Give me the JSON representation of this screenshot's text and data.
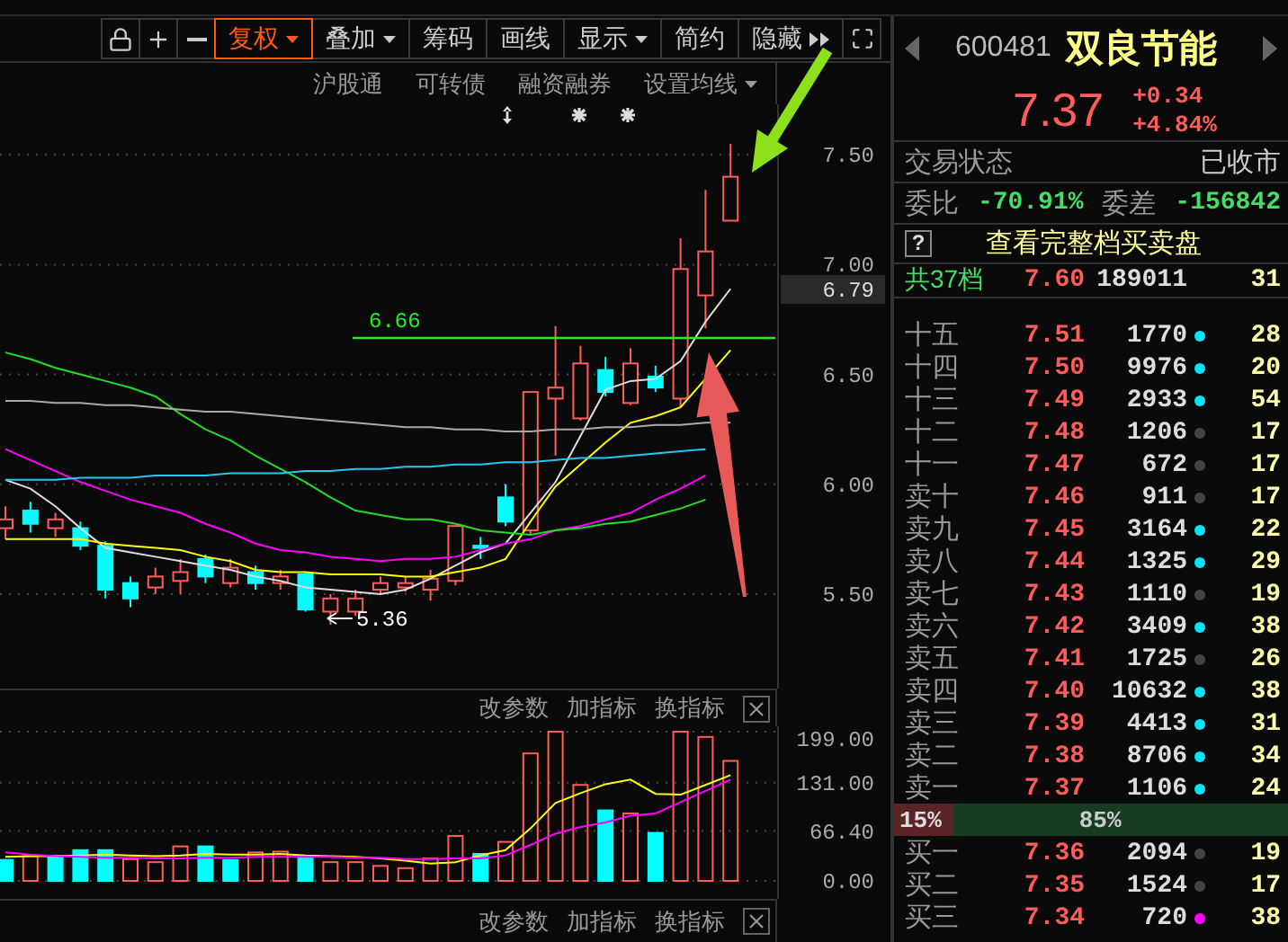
{
  "toolbar": {
    "buttons": [
      {
        "label": "复权",
        "kind": "menu",
        "selected": true
      },
      {
        "label": "叠加",
        "kind": "menu",
        "selected": false
      },
      {
        "label": "筹码",
        "kind": "plain",
        "selected": false
      },
      {
        "label": "画线",
        "kind": "plain",
        "selected": false
      },
      {
        "label": "显示",
        "kind": "menu",
        "selected": false
      },
      {
        "label": "简约",
        "kind": "plain",
        "selected": false
      },
      {
        "label": "隐藏",
        "kind": "expand",
        "selected": false
      }
    ]
  },
  "sub_toolbar": {
    "links": [
      "沪股通",
      "可转债",
      "融资融券"
    ],
    "setting": "设置均线"
  },
  "price_chart": {
    "current_price": "6.79",
    "support_label": "6.66",
    "low_label": "5.36",
    "chart_data": {
      "type": "candlestick",
      "grid": true,
      "ylim": [
        5.07,
        7.73
      ],
      "ohlc": [
        [
          5.8,
          5.9,
          5.75,
          5.84
        ],
        [
          5.88,
          5.92,
          5.78,
          5.82
        ],
        [
          5.8,
          5.87,
          5.76,
          5.84
        ],
        [
          5.8,
          5.83,
          5.7,
          5.72
        ],
        [
          5.72,
          5.74,
          5.48,
          5.52
        ],
        [
          5.55,
          5.58,
          5.44,
          5.48
        ],
        [
          5.53,
          5.62,
          5.5,
          5.58
        ],
        [
          5.56,
          5.66,
          5.5,
          5.6
        ],
        [
          5.66,
          5.68,
          5.55,
          5.58
        ],
        [
          5.55,
          5.66,
          5.53,
          5.62
        ],
        [
          5.6,
          5.63,
          5.52,
          5.55
        ],
        [
          5.55,
          5.61,
          5.52,
          5.58
        ],
        [
          5.59,
          5.6,
          5.42,
          5.43
        ],
        [
          5.42,
          5.5,
          5.36,
          5.48
        ],
        [
          5.42,
          5.52,
          5.4,
          5.48
        ],
        [
          5.52,
          5.58,
          5.5,
          5.55
        ],
        [
          5.53,
          5.58,
          5.51,
          5.55
        ],
        [
          5.52,
          5.61,
          5.47,
          5.57
        ],
        [
          5.56,
          5.81,
          5.54,
          5.81
        ],
        [
          5.72,
          5.76,
          5.66,
          5.71
        ],
        [
          5.94,
          6.0,
          5.81,
          5.83
        ],
        [
          5.79,
          6.42,
          5.77,
          6.42
        ],
        [
          6.39,
          6.72,
          6.13,
          6.44
        ],
        [
          6.3,
          6.63,
          6.29,
          6.55
        ],
        [
          6.52,
          6.58,
          6.4,
          6.42
        ],
        [
          6.37,
          6.62,
          6.36,
          6.55
        ],
        [
          6.49,
          6.54,
          6.42,
          6.44
        ],
        [
          6.39,
          7.12,
          6.35,
          6.98
        ],
        [
          6.86,
          7.34,
          6.71,
          7.06
        ],
        [
          7.2,
          7.55,
          7.2,
          7.4
        ]
      ],
      "yticks": [
        {
          "value": 7.5,
          "label": "7.50"
        },
        {
          "value": 7,
          "label": "7.00"
        },
        {
          "value": 6.5,
          "label": "6.50"
        },
        {
          "value": 6,
          "label": "6.00"
        },
        {
          "value": 5.5,
          "label": "5.50"
        }
      ],
      "series": [
        {
          "type": "line",
          "color": "#dddddd",
          "values": [
            6.02,
            5.98,
            5.9,
            5.8,
            5.71,
            5.69,
            5.67,
            5.65,
            5.63,
            5.61,
            5.58,
            5.56,
            5.53,
            5.52,
            5.51,
            5.5,
            5.52,
            5.57,
            5.63,
            5.69,
            5.73,
            5.87,
            6.01,
            6.22,
            6.43,
            6.47,
            6.48,
            6.56,
            6.74,
            6.89
          ]
        },
        {
          "type": "line",
          "color": "#ffff00",
          "values": [
            5.75,
            5.75,
            5.75,
            5.75,
            5.73,
            5.72,
            5.71,
            5.7,
            5.67,
            5.65,
            5.61,
            5.6,
            5.6,
            5.59,
            5.59,
            5.59,
            5.58,
            5.58,
            5.6,
            5.62,
            5.66,
            5.83,
            5.99,
            6.09,
            6.19,
            6.28,
            6.31,
            6.35,
            null,
            6.61
          ]
        },
        {
          "type": "line",
          "color": "#ff00ff",
          "values": [
            6.16,
            6.11,
            6.06,
            6.01,
            5.97,
            5.93,
            5.9,
            5.87,
            5.82,
            5.78,
            5.73,
            5.7,
            5.69,
            5.67,
            5.66,
            5.65,
            5.66,
            5.66,
            5.67,
            5.7,
            5.73,
            5.75,
            5.79,
            5.81,
            5.84,
            5.87,
            5.93,
            5.98,
            6.04,
            null
          ]
        },
        {
          "type": "line",
          "color": "#22dd22",
          "values": [
            6.6,
            6.57,
            6.53,
            6.5,
            6.47,
            6.44,
            6.4,
            6.32,
            6.25,
            6.2,
            6.13,
            6.07,
            6.01,
            5.94,
            5.88,
            5.86,
            5.84,
            5.84,
            5.82,
            5.79,
            5.78,
            5.77,
            5.79,
            5.8,
            5.82,
            5.83,
            5.86,
            5.89,
            5.93,
            null
          ]
        },
        {
          "type": "line",
          "color": "#22c8ee",
          "values": [
            6.02,
            6.02,
            6.02,
            6.03,
            6.03,
            6.03,
            6.04,
            6.04,
            6.04,
            6.05,
            6.05,
            6.05,
            6.06,
            6.06,
            6.07,
            6.07,
            6.08,
            6.08,
            6.09,
            6.09,
            6.1,
            6.1,
            6.11,
            6.12,
            6.12,
            6.13,
            6.14,
            6.15,
            6.16,
            null
          ]
        },
        {
          "type": "line",
          "color": "#aaaaaa",
          "values": [
            6.38,
            6.38,
            6.37,
            6.37,
            6.36,
            6.36,
            6.35,
            6.34,
            6.33,
            6.33,
            6.32,
            6.31,
            6.3,
            6.29,
            6.28,
            6.27,
            6.26,
            6.26,
            6.25,
            6.25,
            6.24,
            6.24,
            6.25,
            6.25,
            6.26,
            6.26,
            6.27,
            6.27,
            6.28,
            6.28
          ]
        }
      ]
    }
  },
  "volume_panel": {
    "actions": [
      "改参数",
      "加指标",
      "换指标"
    ],
    "chart_data": {
      "type": "bar",
      "grid": true,
      "ylim": [
        0,
        199
      ],
      "yticks": [
        {
          "value": 0,
          "label": "0.00"
        },
        {
          "value": 66.4,
          "label": "66.40"
        },
        {
          "value": 131,
          "label": "131.00"
        },
        {
          "value": 199,
          "label": "199.00"
        }
      ],
      "series": [
        {
          "color": "#ff5c5c",
          "values": [
            null,
            33,
            null,
            null,
            null,
            29,
            25,
            46,
            null,
            null,
            38,
            39,
            null,
            25,
            25,
            20,
            17,
            30,
            60,
            null,
            52,
            170,
            199,
            128,
            null,
            90,
            null,
            199,
            192,
            160
          ]
        },
        {
          "color": "#00ffff",
          "values": [
            28,
            null,
            33,
            41,
            41,
            null,
            null,
            null,
            46,
            28,
            null,
            null,
            32,
            null,
            null,
            null,
            null,
            null,
            null,
            36,
            null,
            null,
            null,
            null,
            94,
            null,
            64,
            null,
            null,
            null
          ]
        },
        {
          "type": "line",
          "color": "#ffff00",
          "values": [
            32,
            33,
            33,
            34,
            35,
            34,
            33,
            34,
            36,
            35,
            35,
            36,
            34,
            33,
            32,
            30,
            27,
            23,
            25,
            34,
            41,
            70,
            104,
            117,
            129,
            135,
            116,
            115,
            128,
            141
          ]
        },
        {
          "type": "line",
          "color": "#ff00ff",
          "values": [
            38,
            35,
            33,
            32,
            31,
            31,
            30,
            30,
            31,
            31,
            32,
            32,
            32,
            32,
            31,
            31,
            29,
            29,
            30,
            30,
            34,
            48,
            63,
            72,
            78,
            87,
            90,
            105,
            120,
            135
          ]
        }
      ]
    }
  },
  "lower_panel": {
    "actions": [
      "改参数",
      "加指标",
      "换指标"
    ]
  },
  "quote": {
    "code": "600481",
    "name": "双良节能",
    "price": "7.37",
    "change": "+0.34",
    "change_pct": "+4.84%",
    "status_label": "交易状态",
    "status": "已收市",
    "ratio_label": "委比",
    "ratio": "-70.91%",
    "diff_label": "委差",
    "diff": "-156842",
    "help": "?",
    "depth_link": "查看完整档买卖盘",
    "total": {
      "label": "共37档",
      "price": "7.60",
      "volume": "189011",
      "count": "31"
    }
  },
  "asks": [
    {
      "label": "十五",
      "price": "7.51",
      "volume": "1770",
      "color": "#00e5ff",
      "count": "28"
    },
    {
      "label": "十四",
      "price": "7.50",
      "volume": "9976",
      "color": "#00e5ff",
      "count": "20"
    },
    {
      "label": "十三",
      "price": "7.49",
      "volume": "2933",
      "color": "#00e5ff",
      "count": "54"
    },
    {
      "label": "十二",
      "price": "7.48",
      "volume": "1206",
      "color": "#444444",
      "count": "17"
    },
    {
      "label": "十一",
      "price": "7.47",
      "volume": "672",
      "color": "#444444",
      "count": "17"
    },
    {
      "label": "卖十",
      "price": "7.46",
      "volume": "911",
      "color": "#444444",
      "count": "17"
    },
    {
      "label": "卖九",
      "price": "7.45",
      "volume": "3164",
      "color": "#00e5ff",
      "count": "22"
    },
    {
      "label": "卖八",
      "price": "7.44",
      "volume": "1325",
      "color": "#00e5ff",
      "count": "29"
    },
    {
      "label": "卖七",
      "price": "7.43",
      "volume": "1110",
      "color": "#444444",
      "count": "19"
    },
    {
      "label": "卖六",
      "price": "7.42",
      "volume": "3409",
      "color": "#00e5ff",
      "count": "38"
    },
    {
      "label": "卖五",
      "price": "7.41",
      "volume": "1725",
      "color": "#444444",
      "count": "26"
    },
    {
      "label": "卖四",
      "price": "7.40",
      "volume": "10632",
      "color": "#00e5ff",
      "count": "38"
    },
    {
      "label": "卖三",
      "price": "7.39",
      "volume": "4413",
      "color": "#00e5ff",
      "count": "31"
    },
    {
      "label": "卖二",
      "price": "7.38",
      "volume": "8706",
      "color": "#00e5ff",
      "count": "34"
    },
    {
      "label": "卖一",
      "price": "7.37",
      "volume": "1106",
      "color": "#00e5ff",
      "count": "24"
    }
  ],
  "balance": {
    "sell": "15%",
    "buy": "85%",
    "level": 0.15
  },
  "bids": [
    {
      "label": "买一",
      "price": "7.36",
      "volume": "2094",
      "color": "#444444",
      "count": "19"
    },
    {
      "label": "买二",
      "price": "7.35",
      "volume": "1524",
      "color": "#444444",
      "count": "17"
    },
    {
      "label": "买三",
      "price": "7.34",
      "volume": "720",
      "color": "#ff00ff",
      "count": "38"
    }
  ]
}
